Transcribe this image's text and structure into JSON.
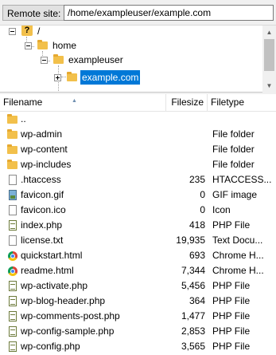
{
  "remote_site": {
    "label": "Remote site:",
    "path": "/home/exampleuser/example.com"
  },
  "tree": {
    "root": "/",
    "home": "home",
    "user": "exampleuser",
    "site": "example.com"
  },
  "columns": {
    "filename": "Filename",
    "filesize": "Filesize",
    "filetype": "Filetype"
  },
  "files": [
    {
      "name": "..",
      "size": "",
      "type": "",
      "icon": "folder-icon"
    },
    {
      "name": "wp-admin",
      "size": "",
      "type": "File folder",
      "icon": "folder-icon"
    },
    {
      "name": "wp-content",
      "size": "",
      "type": "File folder",
      "icon": "folder-icon"
    },
    {
      "name": "wp-includes",
      "size": "",
      "type": "File folder",
      "icon": "folder-icon"
    },
    {
      "name": ".htaccess",
      "size": "235",
      "type": "HTACCESS...",
      "icon": "file-icon"
    },
    {
      "name": "favicon.gif",
      "size": "0",
      "type": "GIF image",
      "icon": "image-icon"
    },
    {
      "name": "favicon.ico",
      "size": "0",
      "type": "Icon",
      "icon": "file-icon"
    },
    {
      "name": "index.php",
      "size": "418",
      "type": "PHP File",
      "icon": "php-file-icon"
    },
    {
      "name": "license.txt",
      "size": "19,935",
      "type": "Text Docu...",
      "icon": "file-icon"
    },
    {
      "name": "quickstart.html",
      "size": "693",
      "type": "Chrome H...",
      "icon": "chrome-icon"
    },
    {
      "name": "readme.html",
      "size": "7,344",
      "type": "Chrome H...",
      "icon": "chrome-icon"
    },
    {
      "name": "wp-activate.php",
      "size": "5,456",
      "type": "PHP File",
      "icon": "php-file-icon"
    },
    {
      "name": "wp-blog-header.php",
      "size": "364",
      "type": "PHP File",
      "icon": "php-file-icon"
    },
    {
      "name": "wp-comments-post.php",
      "size": "1,477",
      "type": "PHP File",
      "icon": "php-file-icon"
    },
    {
      "name": "wp-config-sample.php",
      "size": "2,853",
      "type": "PHP File",
      "icon": "php-file-icon"
    },
    {
      "name": "wp-config.php",
      "size": "3,565",
      "type": "PHP File",
      "icon": "php-file-icon"
    }
  ],
  "colors": {
    "selection": "#0078d7",
    "folder": "#f2c04b"
  }
}
